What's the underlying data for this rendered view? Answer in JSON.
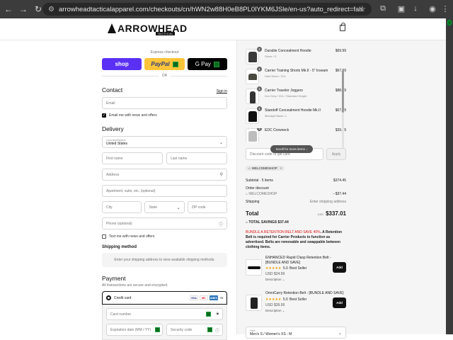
{
  "browser": {
    "url": "arrowheadtacticalapparel.com/checkouts/cn/hWN2w88H0eB8PL0lYKM6JSle/en-us?auto_redirect=false&edge_redirect=true&skip_shop..."
  },
  "header": {
    "logo_text": "ARROWHEAD",
    "logo_sub": "TACTICAL"
  },
  "express": {
    "label": "Express checkout",
    "shop": "shop",
    "paypal": "PayPal",
    "gpay": "G Pay",
    "or": "OR"
  },
  "contact": {
    "title": "Contact",
    "signin": "Sign in",
    "email_placeholder": "Email",
    "newsletter": "Email me with news and offers"
  },
  "delivery": {
    "title": "Delivery",
    "country_label": "Country/Region",
    "country_value": "United States",
    "first_name": "First name",
    "last_name": "Last name",
    "address": "Address",
    "apartment": "Apartment, suite, etc. (optional)",
    "city": "City",
    "state": "State",
    "zip": "ZIP code",
    "phone": "Phone (optional)",
    "text_me": "Text me with news and offers"
  },
  "shipping": {
    "title": "Shipping method",
    "note": "Enter your shipping address to view available shipping methods."
  },
  "payment": {
    "title": "Payment",
    "subtitle": "All transactions are secure and encrypted.",
    "method": "Credit card",
    "card_logos": [
      "VISA",
      "MC",
      "AMEX"
    ],
    "more": "+6",
    "card_number": "Card number",
    "expiration": "Expiration date (MM / YY)",
    "security_code": "Security code"
  },
  "cart": {
    "items": [
      {
        "qty": "1",
        "name": "Durable Concealment Hoodie",
        "variant": "Stone / S",
        "price": "$69.99"
      },
      {
        "qty": "1",
        "name": "Carrier Training Shorts Mk.II - 5\" Inseam",
        "variant": "Dark Moss / SXL",
        "price": "$67.99"
      },
      {
        "qty": "1",
        "name": "Carrier Traveler Joggers",
        "variant": "Iron Grey / 3XL / Standard Height",
        "price": "$88.49"
      },
      {
        "qty": "1",
        "name": "Standoff Concealment Hoodie Mk.II",
        "variant": "Midnight Black / L",
        "price": "$67.99"
      },
      {
        "qty": "1",
        "name": "EDC Crewneck",
        "variant": "",
        "price": "$39.99"
      }
    ],
    "scroll_hint": "Scroll for more items ↓"
  },
  "discount": {
    "placeholder": "Discount code or gift card",
    "apply": "Apply",
    "code": "WELCOMESHOP"
  },
  "summary": {
    "subtotal_label": "Subtotal · 5 items",
    "subtotal": "$374.45",
    "order_discount_label": "Order discount",
    "discount_code": "WELCOMESHOP",
    "discount_amount": "−$37.44",
    "shipping_label": "Shipping",
    "shipping_value": "Enter shipping address",
    "total_label": "Total",
    "currency": "USD",
    "total": "$337.01",
    "savings": "TOTAL SAVINGS  $37.44"
  },
  "promo": {
    "red": "BUNDLE A RETENTION BELT AND SAVE 40%",
    "text": ". A Retention Belt is required for Carrier Products to function as advertised. Belts are removable and swappable between clothing items."
  },
  "upsells": [
    {
      "name": "ENHANCED Rapid Clasp Retention Belt - [BUNDLE AND SAVE]",
      "rating": "5.0",
      "badge": "Best Seller",
      "price": "USD $24.99",
      "desc": "Description ⌄",
      "add": "Add"
    },
    {
      "name": "OmniCarry Retention Belt - [BUNDLE AND SAVE]",
      "rating": "5.0",
      "badge": "Best Seller",
      "price": "USD $39.99",
      "desc": "Description ⌄",
      "add": "Add"
    }
  ],
  "size_select": {
    "label": "Size",
    "value": "Men's S / Women's XS - M"
  }
}
